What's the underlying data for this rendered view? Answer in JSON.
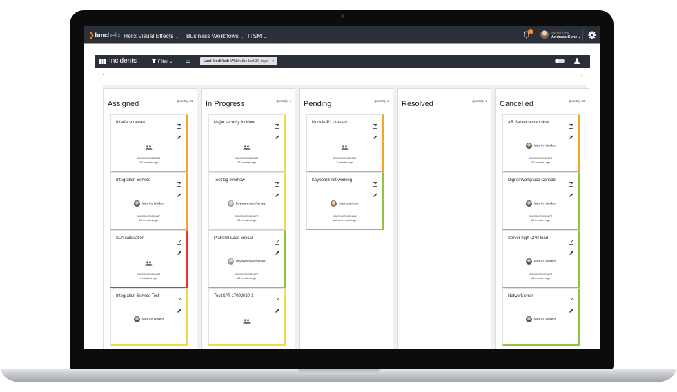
{
  "nav": {
    "brand_bmc": "bmc",
    "brand_helix": "helix",
    "items": [
      {
        "label": "Helix Visual Effects"
      },
      {
        "label": "Business Workflows"
      },
      {
        "label": "ITSM"
      }
    ],
    "notification_count": "2",
    "signed_in_label": "Signed in As",
    "user_name": "Andreas Kunz"
  },
  "toolbar": {
    "title": "Incidents",
    "filter_label": "Filter",
    "chip_key": "Last Modified:",
    "chip_value": "Within the last 30 days",
    "chip_close": "×"
  },
  "columns": [
    {
      "title": "Assigned",
      "quantity": "Quantity: 31",
      "cards": [
        {
          "title": "Interface restart",
          "assignee": "",
          "id": "INC000000058504",
          "time": "17 minutes ago",
          "color": "#f5a623"
        },
        {
          "title": "Integration Service",
          "assignee": "Max Co Worker",
          "id": "INC000000059112",
          "time": "18 minutes ago",
          "color": "#f5a623"
        },
        {
          "title": "SLA calculation",
          "assignee": "",
          "id": "INC000000059150",
          "time": "3 minutes ago",
          "color": "#e8352e"
        },
        {
          "title": "Integration Service Test",
          "assignee": "Max Co Worker",
          "id": "",
          "time": "",
          "color": "#f2d94e"
        }
      ]
    },
    {
      "title": "In Progress",
      "quantity": "Quantity: 4",
      "cards": [
        {
          "title": "Major security Incident",
          "assignee": "",
          "id": "INC000000058900",
          "time": "16 minutes ago",
          "color": "#f2d94e"
        },
        {
          "title": "Test log overflow",
          "assignee": "Dnyaneshwar Nanaw.",
          "id": "INC000000059170",
          "time": "15 minutes ago",
          "color": "#f2d94e"
        },
        {
          "title": "Platform Load critical",
          "assignee": "Dnyaneshwar Nanaw.",
          "id": "INC000000059172",
          "time": "15 minutes ago",
          "color": "#8cc63f"
        },
        {
          "title": "Test SAT 17092020-1",
          "assignee": "",
          "id": "",
          "time": "",
          "color": "#f2d94e"
        }
      ]
    },
    {
      "title": "Pending",
      "quantity": "Quantity: 2",
      "cards": [
        {
          "title": "Module P1 - restart",
          "assignee": "",
          "id": "INC000000059102",
          "time": "2 minutes ago",
          "color": "#f5a623"
        },
        {
          "title": "Keyboard not working",
          "assignee": "Andreas Kunz",
          "id": "INC000000059144",
          "time": "a few seconds ago",
          "color": "#8cc63f"
        }
      ]
    },
    {
      "title": "Resolved",
      "quantity": "Quantity: 0",
      "cards": []
    },
    {
      "title": "Cancelled",
      "quantity": "Quantity: 40",
      "cards": [
        {
          "title": "AR Server restart slow",
          "assignee": "Max Co Worker",
          "id": "INC000000059176",
          "time": "20 minutes ago",
          "color": "#f5a623"
        },
        {
          "title": "Digital Workplace Console",
          "assignee": "Max Co Worker",
          "id": "INC000000059178",
          "time": "19 minutes ago",
          "color": "#8cc63f"
        },
        {
          "title": "Server high CPU load",
          "assignee": "Max Co Worker",
          "id": "INC000000059179",
          "time": "19 minutes ago",
          "color": "#8cc63f"
        },
        {
          "title": "Network error",
          "assignee": "Max Co Worker",
          "id": "",
          "time": "",
          "color": "#8cc63f"
        }
      ]
    }
  ]
}
